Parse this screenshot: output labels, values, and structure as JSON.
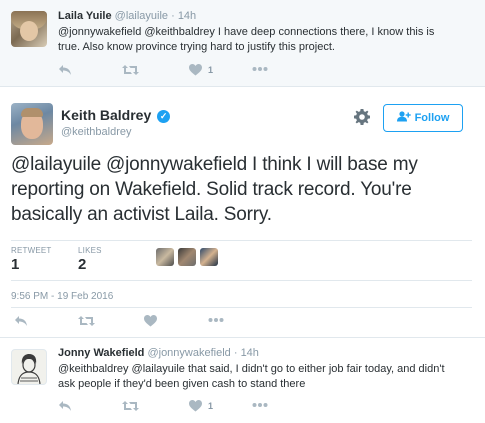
{
  "reply_top": {
    "name": "Laila Yuile",
    "handle": "@lailayuile",
    "time": "· 14h",
    "text_line1": "@jonnywakefield @keithbaldrey I have deep connections there, I know this is",
    "text_line2": "true. Also know province trying hard to justify this project.",
    "like_count": "1"
  },
  "main_tweet": {
    "name": "Keith Baldrey",
    "handle": "@keithbaldrey",
    "follow_label": "Follow",
    "text": "@lailayuile @jonnywakefield I think I will base my reporting on Wakefield. Solid track record. You're basically an activist Laila. Sorry.",
    "retweets_label": "RETWEET",
    "retweets_value": "1",
    "likes_label": "LIKES",
    "likes_value": "2",
    "timestamp": "9:56 PM - 19 Feb 2016"
  },
  "reply_bottom": {
    "name": "Jonny Wakefield",
    "handle": "@jonnywakefield",
    "time": "· 14h",
    "text_line1": "@keithbaldrey @lailayuile that said, I didn't go to either job fair today, and didn't",
    "text_line2": "ask people if they'd been given cash to stand there",
    "like_count": "1"
  },
  "icons": {
    "reply": "reply-icon",
    "retweet": "retweet-icon",
    "like": "heart-icon",
    "more": "more-icon",
    "gear": "gear-icon",
    "verified": "verified-badge-icon",
    "follow": "add-user-icon"
  },
  "colors": {
    "accent": "#1da1f2",
    "muted": "#8899a6",
    "action_gray": "#aab8c2",
    "text": "#292f33",
    "reply_bg": "#f5f8fa"
  }
}
